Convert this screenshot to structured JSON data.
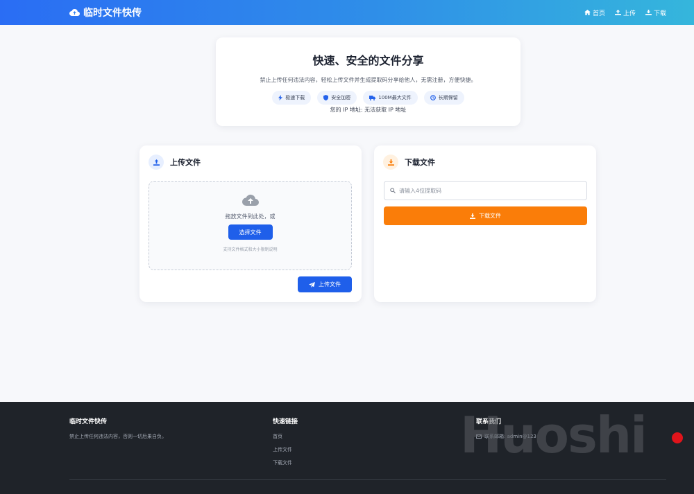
{
  "navbar": {
    "brand": "临时文件快传",
    "links": [
      {
        "label": "首页",
        "icon": "home-icon"
      },
      {
        "label": "上传",
        "icon": "upload-user-icon"
      },
      {
        "label": "下载",
        "icon": "download-icon"
      }
    ]
  },
  "hero": {
    "title": "快速、安全的文件分享",
    "subtitle": "禁止上传任何违法内容，轻松上传文件并生成提取码分享给他人，无需注册，方便快捷。",
    "badges": [
      {
        "label": "极速下载",
        "icon": "bolt-icon"
      },
      {
        "label": "安全加密",
        "icon": "shield-icon"
      },
      {
        "label": "100M最大文件",
        "icon": "truck-icon"
      },
      {
        "label": "长期保留",
        "icon": "clock-icon"
      }
    ],
    "ip_text": "您的 IP 地址: 无法获取 IP 地址"
  },
  "upload": {
    "title": "上传文件",
    "drop_text": "拖放文件到此处，或",
    "choose_label": "选择文件",
    "hint": "支持文件格式和大小限制说明",
    "upload_label": "上传文件"
  },
  "download": {
    "title": "下载文件",
    "placeholder": "请输入4位提取码",
    "download_label": "下载文件"
  },
  "footer": {
    "col1": {
      "title": "临时文件快传",
      "text": "禁止上传任何违法内容，否则一切后果自负。"
    },
    "col2": {
      "title": "快速链接",
      "links": [
        "首页",
        "上传文件",
        "下载文件"
      ]
    },
    "col3": {
      "title": "联系我们",
      "contact": "联系邮箱: admin@123"
    },
    "watermark": "Huoshi"
  },
  "colors": {
    "primary": "#1f5fea",
    "orange": "#fa7d09",
    "footer": "#1f2329"
  }
}
